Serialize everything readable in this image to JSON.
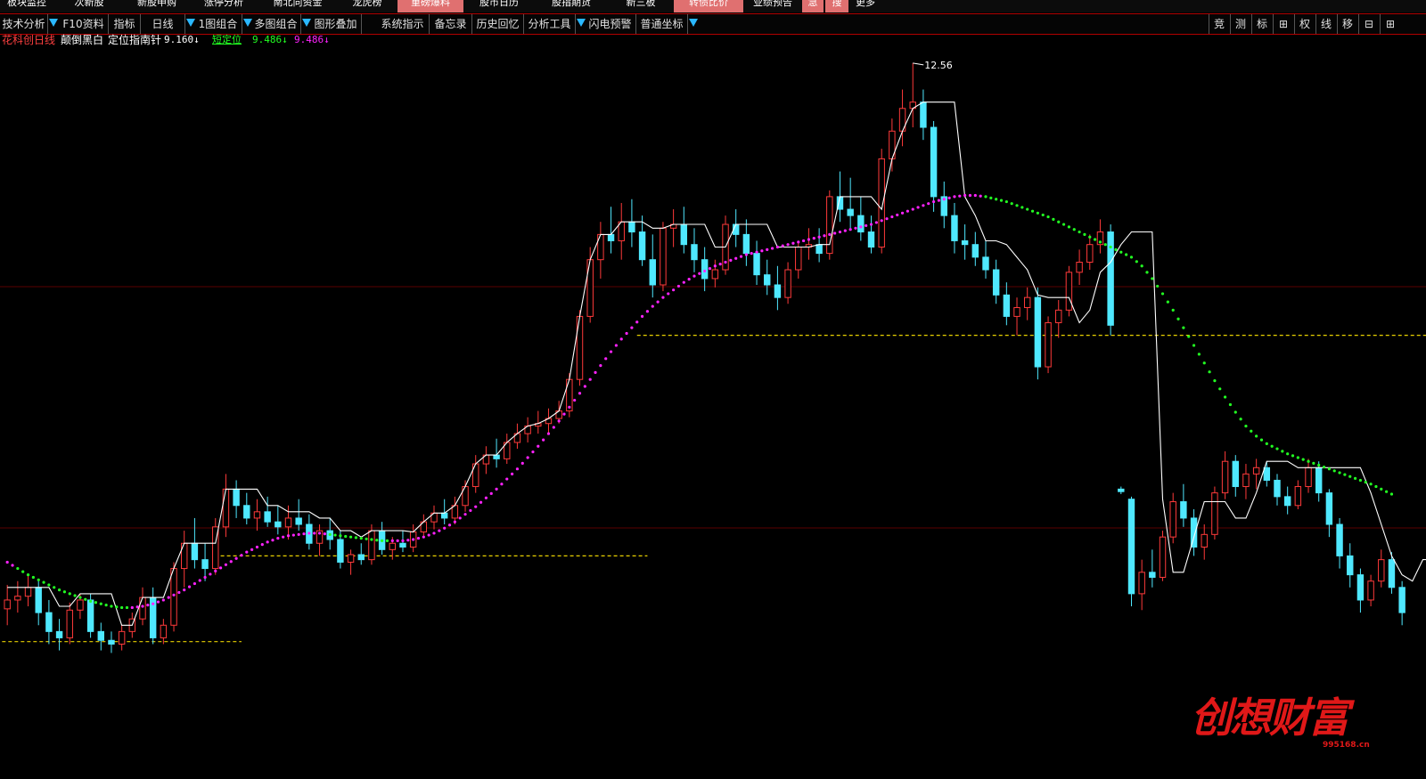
{
  "top_nav": [
    {
      "label": "板块监控",
      "bg": "#0c0c0c"
    },
    {
      "label": "次新股",
      "bg": "#0c0c0c"
    },
    {
      "label": "新股申购",
      "bg": "#0c0c0c"
    },
    {
      "label": "涨停分析",
      "bg": "#0c0c0c"
    },
    {
      "label": "南北向资金",
      "bg": "#0c0c0c"
    },
    {
      "label": "龙虎榜",
      "bg": "#0c0c0c"
    },
    {
      "label": "重磅爆料",
      "bg": "#e07070"
    },
    {
      "label": "股市日历",
      "bg": "#0c0c0c"
    },
    {
      "label": "股指期货",
      "bg": "#0c0c0c"
    },
    {
      "label": "新三板",
      "bg": "#0c0c0c"
    },
    {
      "label": "转债比价",
      "bg": "#e07070"
    },
    {
      "label": "业绩预告",
      "bg": "#0c0c0c"
    },
    {
      "label": "急",
      "bg": "#e07070"
    },
    {
      "label": "搜",
      "bg": "#e07070"
    },
    {
      "label": "更多",
      "bg": "#0c0c0c"
    }
  ],
  "toolbar": {
    "items": [
      "技术分析",
      "F10资料",
      "指标",
      "日线",
      "1图组合",
      "多图组合",
      "图形叠加",
      "系统指示",
      "备忘录",
      "历史回忆",
      "分析工具",
      "闪电预警",
      "普通坐标"
    ],
    "right": [
      "竞",
      "测",
      "标",
      "⊞",
      "权",
      "线",
      "移",
      "⊟",
      "⊞"
    ]
  },
  "indicator": {
    "stock_name": "花科创",
    "period": "日线",
    "mode": "颠倒黑白",
    "name": "定位指南针",
    "value1": "9.160↓",
    "label2": "短定位",
    "value2": "9.486↓",
    "value3": "9.486↓"
  },
  "chart_data": {
    "type": "candlestick",
    "title": "",
    "max_label": "12.56",
    "y_range": [
      6.88,
      12.7
    ],
    "colors": {
      "up": "#ff3a3a",
      "down": "#4fe8ff",
      "line": "#ffffff",
      "ma_up": "#ff22ff",
      "ma_down": "#22ff22",
      "support": "#e8d000"
    },
    "candles": [
      {
        "o": 8.23,
        "h": 8.42,
        "l": 8.1,
        "c": 8.3
      },
      {
        "o": 8.3,
        "h": 8.45,
        "l": 8.2,
        "c": 8.33
      },
      {
        "o": 8.33,
        "h": 8.5,
        "l": 8.25,
        "c": 8.4
      },
      {
        "o": 8.4,
        "h": 8.45,
        "l": 8.1,
        "c": 8.2
      },
      {
        "o": 8.2,
        "h": 8.3,
        "l": 7.95,
        "c": 8.05
      },
      {
        "o": 8.05,
        "h": 8.15,
        "l": 7.9,
        "c": 8.0
      },
      {
        "o": 8.0,
        "h": 8.28,
        "l": 7.95,
        "c": 8.22
      },
      {
        "o": 8.22,
        "h": 8.35,
        "l": 8.15,
        "c": 8.3
      },
      {
        "o": 8.3,
        "h": 8.35,
        "l": 8.0,
        "c": 8.05
      },
      {
        "o": 8.05,
        "h": 8.12,
        "l": 7.9,
        "c": 7.98
      },
      {
        "o": 7.98,
        "h": 8.05,
        "l": 7.88,
        "c": 7.95
      },
      {
        "o": 7.95,
        "h": 8.1,
        "l": 7.9,
        "c": 8.05
      },
      {
        "o": 8.05,
        "h": 8.2,
        "l": 8.0,
        "c": 8.15
      },
      {
        "o": 8.15,
        "h": 8.4,
        "l": 8.1,
        "c": 8.32
      },
      {
        "o": 8.32,
        "h": 8.4,
        "l": 7.95,
        "c": 8.0
      },
      {
        "o": 8.0,
        "h": 8.15,
        "l": 7.95,
        "c": 8.1
      },
      {
        "o": 8.1,
        "h": 8.6,
        "l": 8.05,
        "c": 8.55
      },
      {
        "o": 8.55,
        "h": 8.85,
        "l": 8.4,
        "c": 8.75
      },
      {
        "o": 8.75,
        "h": 8.95,
        "l": 8.55,
        "c": 8.62
      },
      {
        "o": 8.62,
        "h": 8.75,
        "l": 8.45,
        "c": 8.55
      },
      {
        "o": 8.55,
        "h": 8.95,
        "l": 8.5,
        "c": 8.88
      },
      {
        "o": 8.88,
        "h": 9.3,
        "l": 8.8,
        "c": 9.18
      },
      {
        "o": 9.18,
        "h": 9.25,
        "l": 8.95,
        "c": 9.05
      },
      {
        "o": 9.05,
        "h": 9.15,
        "l": 8.9,
        "c": 8.95
      },
      {
        "o": 8.95,
        "h": 9.1,
        "l": 8.85,
        "c": 9.0
      },
      {
        "o": 9.0,
        "h": 9.12,
        "l": 8.88,
        "c": 8.92
      },
      {
        "o": 8.92,
        "h": 9.05,
        "l": 8.82,
        "c": 8.88
      },
      {
        "o": 8.88,
        "h": 9.05,
        "l": 8.78,
        "c": 8.95
      },
      {
        "o": 8.95,
        "h": 9.1,
        "l": 8.85,
        "c": 8.9
      },
      {
        "o": 8.9,
        "h": 8.98,
        "l": 8.7,
        "c": 8.75
      },
      {
        "o": 8.75,
        "h": 8.9,
        "l": 8.65,
        "c": 8.85
      },
      {
        "o": 8.85,
        "h": 8.95,
        "l": 8.7,
        "c": 8.78
      },
      {
        "o": 8.78,
        "h": 8.85,
        "l": 8.55,
        "c": 8.6
      },
      {
        "o": 8.6,
        "h": 8.7,
        "l": 8.5,
        "c": 8.66
      },
      {
        "o": 8.66,
        "h": 8.75,
        "l": 8.58,
        "c": 8.62
      },
      {
        "o": 8.62,
        "h": 8.9,
        "l": 8.58,
        "c": 8.85
      },
      {
        "o": 8.85,
        "h": 8.92,
        "l": 8.66,
        "c": 8.7
      },
      {
        "o": 8.7,
        "h": 8.8,
        "l": 8.62,
        "c": 8.75
      },
      {
        "o": 8.75,
        "h": 8.85,
        "l": 8.68,
        "c": 8.72
      },
      {
        "o": 8.72,
        "h": 8.9,
        "l": 8.68,
        "c": 8.84
      },
      {
        "o": 8.84,
        "h": 8.98,
        "l": 8.8,
        "c": 8.92
      },
      {
        "o": 8.92,
        "h": 9.05,
        "l": 8.86,
        "c": 8.99
      },
      {
        "o": 8.99,
        "h": 9.1,
        "l": 8.9,
        "c": 8.95
      },
      {
        "o": 8.95,
        "h": 9.12,
        "l": 8.9,
        "c": 9.05
      },
      {
        "o": 9.05,
        "h": 9.25,
        "l": 9.0,
        "c": 9.2
      },
      {
        "o": 9.2,
        "h": 9.45,
        "l": 9.15,
        "c": 9.38
      },
      {
        "o": 9.38,
        "h": 9.52,
        "l": 9.3,
        "c": 9.45
      },
      {
        "o": 9.45,
        "h": 9.58,
        "l": 9.35,
        "c": 9.42
      },
      {
        "o": 9.42,
        "h": 9.62,
        "l": 9.38,
        "c": 9.55
      },
      {
        "o": 9.55,
        "h": 9.7,
        "l": 9.5,
        "c": 9.62
      },
      {
        "o": 9.62,
        "h": 9.75,
        "l": 9.55,
        "c": 9.68
      },
      {
        "o": 9.68,
        "h": 9.8,
        "l": 9.62,
        "c": 9.7
      },
      {
        "o": 9.7,
        "h": 9.82,
        "l": 9.62,
        "c": 9.74
      },
      {
        "o": 9.74,
        "h": 9.88,
        "l": 9.7,
        "c": 9.8
      },
      {
        "o": 9.8,
        "h": 10.1,
        "l": 9.75,
        "c": 10.05
      },
      {
        "o": 10.05,
        "h": 10.6,
        "l": 10.0,
        "c": 10.55
      },
      {
        "o": 10.55,
        "h": 11.1,
        "l": 10.5,
        "c": 11.0
      },
      {
        "o": 11.0,
        "h": 11.3,
        "l": 10.85,
        "c": 11.2
      },
      {
        "o": 11.2,
        "h": 11.42,
        "l": 11.05,
        "c": 11.15
      },
      {
        "o": 11.15,
        "h": 11.45,
        "l": 11.0,
        "c": 11.3
      },
      {
        "o": 11.3,
        "h": 11.48,
        "l": 11.1,
        "c": 11.22
      },
      {
        "o": 11.22,
        "h": 11.35,
        "l": 10.95,
        "c": 11.0
      },
      {
        "o": 11.0,
        "h": 11.2,
        "l": 10.7,
        "c": 10.8
      },
      {
        "o": 10.8,
        "h": 11.3,
        "l": 10.75,
        "c": 11.25
      },
      {
        "o": 11.25,
        "h": 11.4,
        "l": 11.1,
        "c": 11.28
      },
      {
        "o": 11.28,
        "h": 11.42,
        "l": 11.05,
        "c": 11.12
      },
      {
        "o": 11.12,
        "h": 11.25,
        "l": 10.9,
        "c": 11.0
      },
      {
        "o": 11.0,
        "h": 11.1,
        "l": 10.75,
        "c": 10.85
      },
      {
        "o": 10.85,
        "h": 11.0,
        "l": 10.78,
        "c": 10.92
      },
      {
        "o": 10.92,
        "h": 11.35,
        "l": 10.88,
        "c": 11.28
      },
      {
        "o": 11.28,
        "h": 11.4,
        "l": 11.1,
        "c": 11.2
      },
      {
        "o": 11.2,
        "h": 11.32,
        "l": 10.95,
        "c": 11.05
      },
      {
        "o": 11.05,
        "h": 11.15,
        "l": 10.8,
        "c": 10.88
      },
      {
        "o": 10.88,
        "h": 11.0,
        "l": 10.72,
        "c": 10.8
      },
      {
        "o": 10.8,
        "h": 10.95,
        "l": 10.6,
        "c": 10.7
      },
      {
        "o": 10.7,
        "h": 10.98,
        "l": 10.65,
        "c": 10.92
      },
      {
        "o": 10.92,
        "h": 11.15,
        "l": 10.85,
        "c": 11.1
      },
      {
        "o": 11.1,
        "h": 11.25,
        "l": 11.0,
        "c": 11.12
      },
      {
        "o": 11.12,
        "h": 11.25,
        "l": 10.98,
        "c": 11.05
      },
      {
        "o": 11.05,
        "h": 11.55,
        "l": 11.0,
        "c": 11.5
      },
      {
        "o": 11.5,
        "h": 11.7,
        "l": 11.3,
        "c": 11.4
      },
      {
        "o": 11.4,
        "h": 11.65,
        "l": 11.25,
        "c": 11.35
      },
      {
        "o": 11.35,
        "h": 11.5,
        "l": 11.15,
        "c": 11.22
      },
      {
        "o": 11.22,
        "h": 11.35,
        "l": 11.05,
        "c": 11.1
      },
      {
        "o": 11.1,
        "h": 11.88,
        "l": 11.05,
        "c": 11.8
      },
      {
        "o": 11.8,
        "h": 12.12,
        "l": 11.7,
        "c": 12.02
      },
      {
        "o": 12.02,
        "h": 12.35,
        "l": 11.9,
        "c": 12.2
      },
      {
        "o": 12.2,
        "h": 12.56,
        "l": 12.05,
        "c": 12.25
      },
      {
        "o": 12.25,
        "h": 12.35,
        "l": 11.95,
        "c": 12.05
      },
      {
        "o": 12.05,
        "h": 12.1,
        "l": 11.38,
        "c": 11.5
      },
      {
        "o": 11.5,
        "h": 11.62,
        "l": 11.25,
        "c": 11.35
      },
      {
        "o": 11.35,
        "h": 11.45,
        "l": 11.05,
        "c": 11.15
      },
      {
        "o": 11.15,
        "h": 11.28,
        "l": 11.0,
        "c": 11.12
      },
      {
        "o": 11.12,
        "h": 11.22,
        "l": 10.95,
        "c": 11.02
      },
      {
        "o": 11.02,
        "h": 11.15,
        "l": 10.85,
        "c": 10.92
      },
      {
        "o": 10.92,
        "h": 11.0,
        "l": 10.65,
        "c": 10.72
      },
      {
        "o": 10.72,
        "h": 10.82,
        "l": 10.48,
        "c": 10.55
      },
      {
        "o": 10.55,
        "h": 10.7,
        "l": 10.4,
        "c": 10.62
      },
      {
        "o": 10.62,
        "h": 10.78,
        "l": 10.52,
        "c": 10.7
      },
      {
        "o": 10.7,
        "h": 10.78,
        "l": 10.05,
        "c": 10.15
      },
      {
        "o": 10.15,
        "h": 10.55,
        "l": 10.1,
        "c": 10.5
      },
      {
        "o": 10.5,
        "h": 10.68,
        "l": 10.38,
        "c": 10.6
      },
      {
        "o": 10.6,
        "h": 10.95,
        "l": 10.55,
        "c": 10.9
      },
      {
        "o": 10.9,
        "h": 11.08,
        "l": 10.8,
        "c": 10.98
      },
      {
        "o": 10.98,
        "h": 11.2,
        "l": 10.92,
        "c": 11.12
      },
      {
        "o": 11.12,
        "h": 11.32,
        "l": 11.05,
        "c": 11.22
      },
      {
        "o": 11.22,
        "h": 11.28,
        "l": 10.4,
        "c": 10.48
      },
      {
        "o": 9.18,
        "h": 9.2,
        "l": 9.14,
        "c": 9.16
      },
      {
        "o": 9.1,
        "h": 9.12,
        "l": 8.25,
        "c": 8.35
      },
      {
        "o": 8.35,
        "h": 8.62,
        "l": 8.22,
        "c": 8.52
      },
      {
        "o": 8.52,
        "h": 8.7,
        "l": 8.4,
        "c": 8.48
      },
      {
        "o": 8.48,
        "h": 8.85,
        "l": 8.45,
        "c": 8.8
      },
      {
        "o": 8.8,
        "h": 9.15,
        "l": 8.75,
        "c": 9.08
      },
      {
        "o": 9.08,
        "h": 9.22,
        "l": 8.88,
        "c": 8.95
      },
      {
        "o": 8.95,
        "h": 9.02,
        "l": 8.65,
        "c": 8.72
      },
      {
        "o": 8.72,
        "h": 8.9,
        "l": 8.62,
        "c": 8.82
      },
      {
        "o": 8.82,
        "h": 9.2,
        "l": 8.78,
        "c": 9.15
      },
      {
        "o": 9.15,
        "h": 9.48,
        "l": 9.1,
        "c": 9.4
      },
      {
        "o": 9.4,
        "h": 9.45,
        "l": 9.12,
        "c": 9.2
      },
      {
        "o": 9.2,
        "h": 9.38,
        "l": 9.1,
        "c": 9.3
      },
      {
        "o": 9.3,
        "h": 9.42,
        "l": 9.18,
        "c": 9.35
      },
      {
        "o": 9.35,
        "h": 9.4,
        "l": 9.2,
        "c": 9.25
      },
      {
        "o": 9.25,
        "h": 9.3,
        "l": 9.05,
        "c": 9.12
      },
      {
        "o": 9.12,
        "h": 9.2,
        "l": 8.98,
        "c": 9.05
      },
      {
        "o": 9.05,
        "h": 9.25,
        "l": 9.02,
        "c": 9.2
      },
      {
        "o": 9.2,
        "h": 9.42,
        "l": 9.15,
        "c": 9.35
      },
      {
        "o": 9.35,
        "h": 9.4,
        "l": 9.08,
        "c": 9.15
      },
      {
        "o": 9.15,
        "h": 9.18,
        "l": 8.8,
        "c": 8.9
      },
      {
        "o": 8.9,
        "h": 8.95,
        "l": 8.55,
        "c": 8.65
      },
      {
        "o": 8.65,
        "h": 8.75,
        "l": 8.4,
        "c": 8.5
      },
      {
        "o": 8.5,
        "h": 8.55,
        "l": 8.2,
        "c": 8.3
      },
      {
        "o": 8.3,
        "h": 8.5,
        "l": 8.25,
        "c": 8.45
      },
      {
        "o": 8.45,
        "h": 8.7,
        "l": 8.4,
        "c": 8.62
      },
      {
        "o": 8.62,
        "h": 8.68,
        "l": 8.35,
        "c": 8.4
      },
      {
        "o": 8.4,
        "h": 8.45,
        "l": 8.1,
        "c": 8.2
      }
    ],
    "line": [
      8.4,
      8.4,
      8.4,
      8.4,
      8.4,
      8.25,
      8.25,
      8.35,
      8.35,
      8.35,
      8.35,
      8.1,
      8.1,
      8.32,
      8.32,
      8.32,
      8.55,
      8.75,
      8.75,
      8.75,
      8.75,
      9.18,
      9.18,
      9.18,
      9.18,
      9.05,
      9.05,
      9.0,
      9.0,
      9.0,
      8.95,
      8.95,
      8.85,
      8.85,
      8.8,
      8.85,
      8.85,
      8.85,
      8.85,
      8.84,
      8.92,
      8.99,
      8.99,
      9.05,
      9.2,
      9.38,
      9.45,
      9.45,
      9.55,
      9.62,
      9.68,
      9.7,
      9.74,
      9.8,
      10.05,
      10.55,
      11.0,
      11.2,
      11.2,
      11.3,
      11.3,
      11.3,
      11.25,
      11.25,
      11.28,
      11.28,
      11.28,
      11.28,
      11.1,
      11.1,
      11.28,
      11.28,
      11.28,
      11.28,
      11.1,
      11.1,
      11.1,
      11.1,
      11.12,
      11.12,
      11.5,
      11.5,
      11.5,
      11.5,
      11.4,
      11.8,
      12.02,
      12.2,
      12.25,
      12.25,
      12.25,
      12.25,
      11.5,
      11.35,
      11.15,
      11.15,
      11.12,
      11.02,
      10.92,
      10.72,
      10.7,
      10.7,
      10.7,
      10.5,
      10.6,
      10.9,
      10.98,
      11.12,
      11.22,
      11.22,
      11.22,
      9.1,
      8.52,
      8.52,
      8.8,
      9.08,
      9.08,
      9.08,
      8.95,
      8.95,
      9.15,
      9.4,
      9.4,
      9.4,
      9.35,
      9.35,
      9.35,
      9.35,
      9.35,
      9.35,
      9.35,
      9.15,
      8.9,
      8.65,
      8.5,
      8.45,
      8.62,
      8.62
    ],
    "ma": [
      8.6,
      8.55,
      8.5,
      8.46,
      8.42,
      8.38,
      8.35,
      8.32,
      8.29,
      8.27,
      8.25,
      8.24,
      8.24,
      8.25,
      8.27,
      8.3,
      8.34,
      8.38,
      8.43,
      8.48,
      8.53,
      8.58,
      8.63,
      8.68,
      8.72,
      8.76,
      8.79,
      8.81,
      8.82,
      8.83,
      8.83,
      8.82,
      8.81,
      8.8,
      8.79,
      8.78,
      8.77,
      8.77,
      8.77,
      8.78,
      8.8,
      8.83,
      8.87,
      8.92,
      8.98,
      9.04,
      9.11,
      9.18,
      9.26,
      9.34,
      9.43,
      9.52,
      9.62,
      9.72,
      9.83,
      9.94,
      10.05,
      10.16,
      10.27,
      10.37,
      10.46,
      10.55,
      10.63,
      10.7,
      10.76,
      10.82,
      10.87,
      10.91,
      10.95,
      10.98,
      11.01,
      11.04,
      11.06,
      11.08,
      11.1,
      11.12,
      11.14,
      11.16,
      11.18,
      11.2,
      11.22,
      11.24,
      11.26,
      11.28,
      11.31,
      11.34,
      11.37,
      11.4,
      11.43,
      11.46,
      11.48,
      11.5,
      11.51,
      11.51,
      11.5,
      11.48,
      11.46,
      11.43,
      11.4,
      11.37,
      11.34,
      11.3,
      11.26,
      11.22,
      11.18,
      11.14,
      11.1,
      11.06,
      11.02,
      10.95,
      10.85,
      10.73,
      10.6,
      10.46,
      10.32,
      10.18,
      10.04,
      9.91,
      9.79,
      9.68,
      9.6,
      9.54,
      9.5,
      9.46,
      9.43,
      9.4,
      9.37,
      9.34,
      9.31,
      9.28,
      9.25,
      9.22,
      9.18,
      9.14
    ],
    "support_levels": [
      {
        "price": 7.97,
        "from": 0,
        "to": 22
      },
      {
        "price": 8.65,
        "from": 21,
        "to": 61
      },
      {
        "price": 10.4,
        "from": 61,
        "to": 140
      }
    ]
  },
  "logo": {
    "text": "创想财富",
    "url": "995168.cn"
  }
}
